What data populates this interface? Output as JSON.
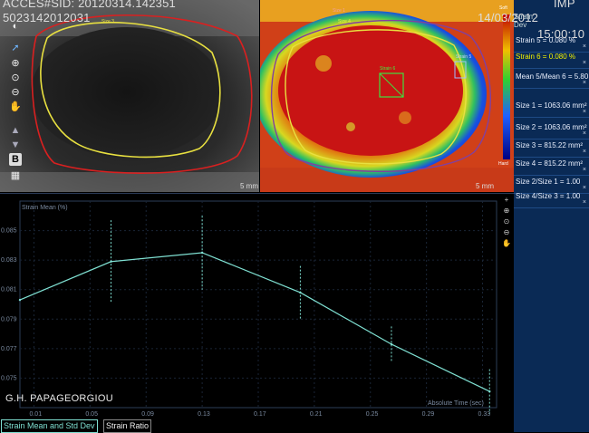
{
  "header": {
    "accession_line": "ACCES#SID: 20120314.142351",
    "id_line": "5023142012031",
    "imp_label": "IMP",
    "date": "14/03/2012",
    "time": "15:00:10"
  },
  "bmode": {
    "roi_size3_label": "Size 3",
    "scale_label": "5 mm",
    "toolbar_b_label": "B"
  },
  "elasto": {
    "roi_size1_label": "Size 1",
    "roi_size4_label": "Size 4",
    "roi_strain6_label": "Strain 6",
    "roi_strain5_label": "Strain 5",
    "scale_label": "5 mm",
    "colorbar_soft_label": "Soft",
    "colorbar_hard_label": "Hard"
  },
  "right_panel": {
    "items": [
      {
        "label": "Strain 5 = 0.080 %",
        "highlight": false
      },
      {
        "label": "Strain 6 = 0.080 %",
        "highlight": true
      },
      {
        "label": "Mean 5/Mean 6 = 5.80",
        "highlight": false
      },
      {
        "label": "Size 1 = 1063.06 mm²",
        "highlight": false
      },
      {
        "label": "Size 2 = 1063.06 mm²",
        "highlight": false
      },
      {
        "label": "Size 3 = 815.22 mm²",
        "highlight": false
      },
      {
        "label": "Size 4 = 815.22 mm²",
        "highlight": false
      },
      {
        "label": "Size 2/Size 1 = 1.00",
        "highlight": false
      },
      {
        "label": "Size 4/Size 3 = 1.00",
        "highlight": false
      }
    ],
    "close_glyph": "×",
    "strain_dev_label": "Strain Dev",
    "colors": {
      "highlight": "#f2f200",
      "background": "#0a2a55"
    }
  },
  "graph": {
    "operator_name": "G.H.  PAPAGEORGIOU",
    "chart_data": {
      "type": "line",
      "title": "",
      "ylabel": "Strain Mean (%)",
      "xlabel": "Absolute Time (sec)",
      "xlim": [
        0.0,
        0.34
      ],
      "ylim": [
        0.073,
        0.087
      ],
      "x_ticks": [
        "0.01",
        "0.05",
        "0.09",
        "0.13",
        "0.17",
        "0.21",
        "0.25",
        "0.29",
        "0.33"
      ],
      "x_tick_values": [
        0.01,
        0.05,
        0.09,
        0.13,
        0.17,
        0.21,
        0.25,
        0.29,
        0.33
      ],
      "y_ticks": [
        "0.085",
        "0.083",
        "0.081",
        "0.079",
        "0.077",
        "0.075"
      ],
      "y_tick_values": [
        0.085,
        0.083,
        0.081,
        0.079,
        0.077,
        0.075
      ],
      "series": [
        {
          "x": [
            0.0,
            0.065,
            0.13,
            0.2,
            0.265,
            0.335
          ],
          "y": [
            0.0803,
            0.0829,
            0.0835,
            0.0808,
            0.0773,
            0.0741
          ],
          "err": [
            0.0,
            0.0028,
            0.0025,
            0.0018,
            0.0012,
            0.0015
          ],
          "color": "#7fe0d2"
        }
      ]
    }
  },
  "tabs": [
    {
      "label": "Strain Mean and Std Dev",
      "active": true
    },
    {
      "label": "Strain Ratio",
      "active": false
    }
  ]
}
